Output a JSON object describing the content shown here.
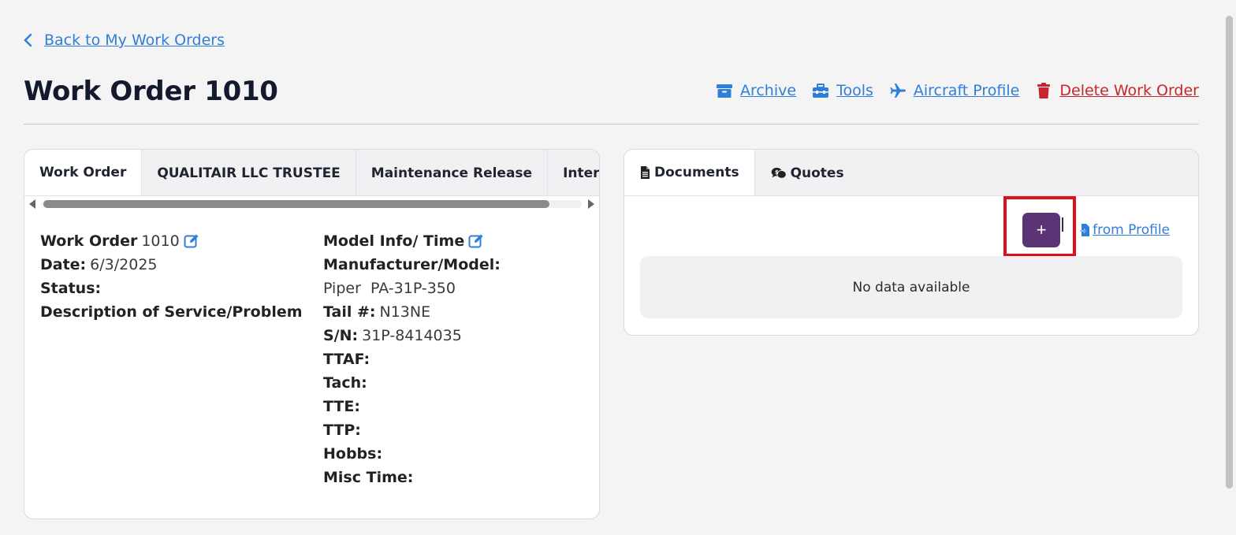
{
  "nav": {
    "back_label": "Back to My Work Orders"
  },
  "header": {
    "title": "Work Order 1010",
    "actions": {
      "archive": "Archive",
      "tools": "Tools",
      "aircraft_profile": "Aircraft Profile",
      "delete": "Delete Work Order"
    }
  },
  "left_card": {
    "tabs": [
      "Work Order",
      "QUALITAIR LLC TRUSTEE",
      "Maintenance Release",
      "Internal Notes"
    ],
    "col1": {
      "work_order_label": "Work Order",
      "work_order_value": "1010",
      "date_label": "Date:",
      "date_value": "6/3/2025",
      "status_label": "Status:",
      "description_label": "Description of Service/Problem"
    },
    "col2": {
      "model_info_label": "Model Info/ Time",
      "manufacturer_label": "Manufacturer/Model:",
      "manufacturer_value": "Piper  PA-31P-350",
      "tail_label": "Tail #:",
      "tail_value": "N13NE",
      "sn_label": "S/N:",
      "sn_value": "31P-8414035",
      "ttaf_label": "TTAF:",
      "tach_label": "Tach:",
      "tte_label": "TTE:",
      "ttp_label": "TTP:",
      "hobbs_label": "Hobbs:",
      "misc_label": "Misc Time:"
    }
  },
  "right_card": {
    "tabs": {
      "documents": "Documents",
      "quotes": "Quotes"
    },
    "add_button": "+",
    "from_profile": "from Profile",
    "empty_text": "No data available"
  },
  "colors": {
    "link": "#2f7fd8",
    "danger": "#c8262c",
    "add_button": "#5a3475",
    "highlight": "#e0101a"
  }
}
